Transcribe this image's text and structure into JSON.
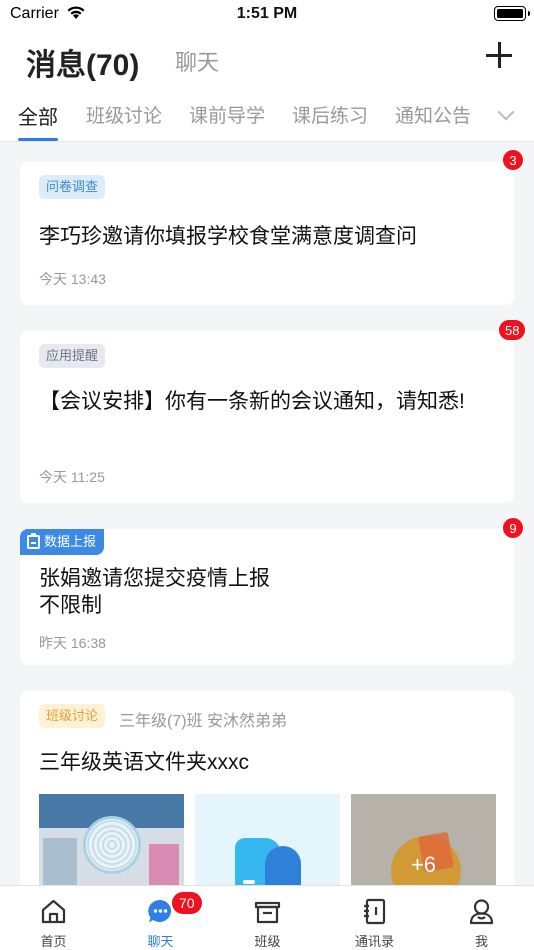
{
  "status_bar": {
    "carrier": "Carrier",
    "time": "1:51 PM"
  },
  "header": {
    "title": "消息(70)",
    "chat_tab": "聊天"
  },
  "tabs": [
    {
      "label": "全部",
      "active": true
    },
    {
      "label": "班级讨论"
    },
    {
      "label": "课前导学"
    },
    {
      "label": "课后练习"
    },
    {
      "label": "通知公告"
    }
  ],
  "cards": [
    {
      "tag": "问卷调查",
      "title": "李巧珍邀请你填报学校食堂满意度调查问",
      "time": "今天 13:43",
      "badge": "3"
    },
    {
      "tag": "应用提醒",
      "title": "【会议安排】你有一条新的会议通知，请知悉!",
      "time": "今天 11:25",
      "badge": "58"
    },
    {
      "tag": "数据上报",
      "title_line1": "张娟邀请您提交疫情上报",
      "title_line2": "不限制",
      "time": "昨天 16:38",
      "badge": "9"
    },
    {
      "tag": "班级讨论",
      "subtitle": "三年级(7)班 安沐然弟弟",
      "title": "三年级英语文件夹xxxc",
      "more_count": "+6"
    }
  ],
  "tabbar": {
    "items": [
      {
        "label": "首页",
        "icon": "home-icon"
      },
      {
        "label": "聊天",
        "icon": "chat-icon",
        "badge": "70",
        "active": true
      },
      {
        "label": "班级",
        "icon": "class-icon"
      },
      {
        "label": "通讯录",
        "icon": "contacts-icon"
      },
      {
        "label": "我",
        "icon": "profile-icon"
      }
    ]
  },
  "colors": {
    "accent": "#2b7cf0",
    "badge": "#f0101e"
  }
}
